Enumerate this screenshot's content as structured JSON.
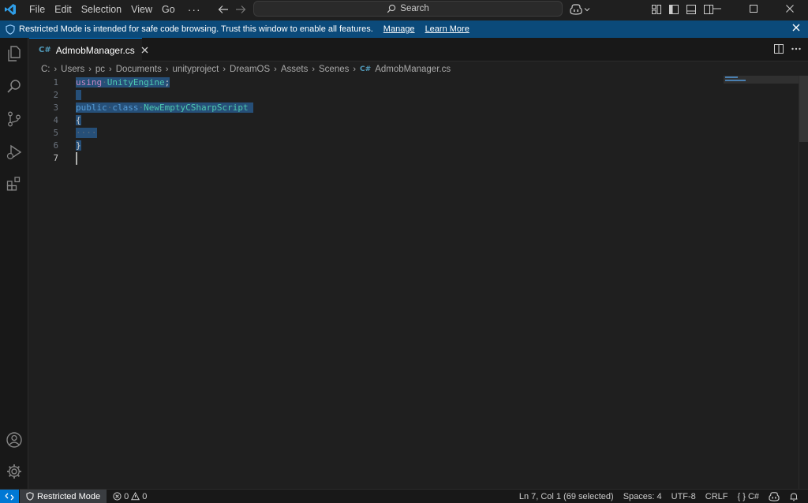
{
  "menu": {
    "items": [
      "File",
      "Edit",
      "Selection",
      "View",
      "Go"
    ],
    "more": "···"
  },
  "search": {
    "label": "Search"
  },
  "banner": {
    "message": "Restricted Mode is intended for safe code browsing. Trust this window to enable all features.",
    "manage": "Manage",
    "learn_more": "Learn More"
  },
  "tab": {
    "label": "AdmobManager.cs",
    "icon_text": "C#"
  },
  "breadcrumb": [
    "C:",
    "Users",
    "pc",
    "Documents",
    "unityproject",
    "DreamOS",
    "Assets",
    "Scenes",
    "AdmobManager.cs"
  ],
  "editor": {
    "line_numbers": [
      "1",
      "2",
      "3",
      "4",
      "5",
      "6",
      "7"
    ],
    "code": {
      "line1_kw": "using",
      "line1_type": "UnityEngine",
      "line1_end": ";",
      "line3_kw1": "public",
      "line3_kw2": "class",
      "line3_type": "NewEmptyCSharpScript",
      "line4": "{",
      "line5": "····",
      "line6": "}"
    }
  },
  "status": {
    "restricted": "Restricted Mode",
    "errors": "0",
    "warnings": "0",
    "position": "Ln 7, Col 1 (69 selected)",
    "spaces": "Spaces: 4",
    "encoding": "UTF-8",
    "eol": "CRLF",
    "language": "C#",
    "language_braces": "{ }"
  },
  "colors": {
    "accent": "#0078d4",
    "banner": "#0b4a7a",
    "selection": "#264f78"
  }
}
